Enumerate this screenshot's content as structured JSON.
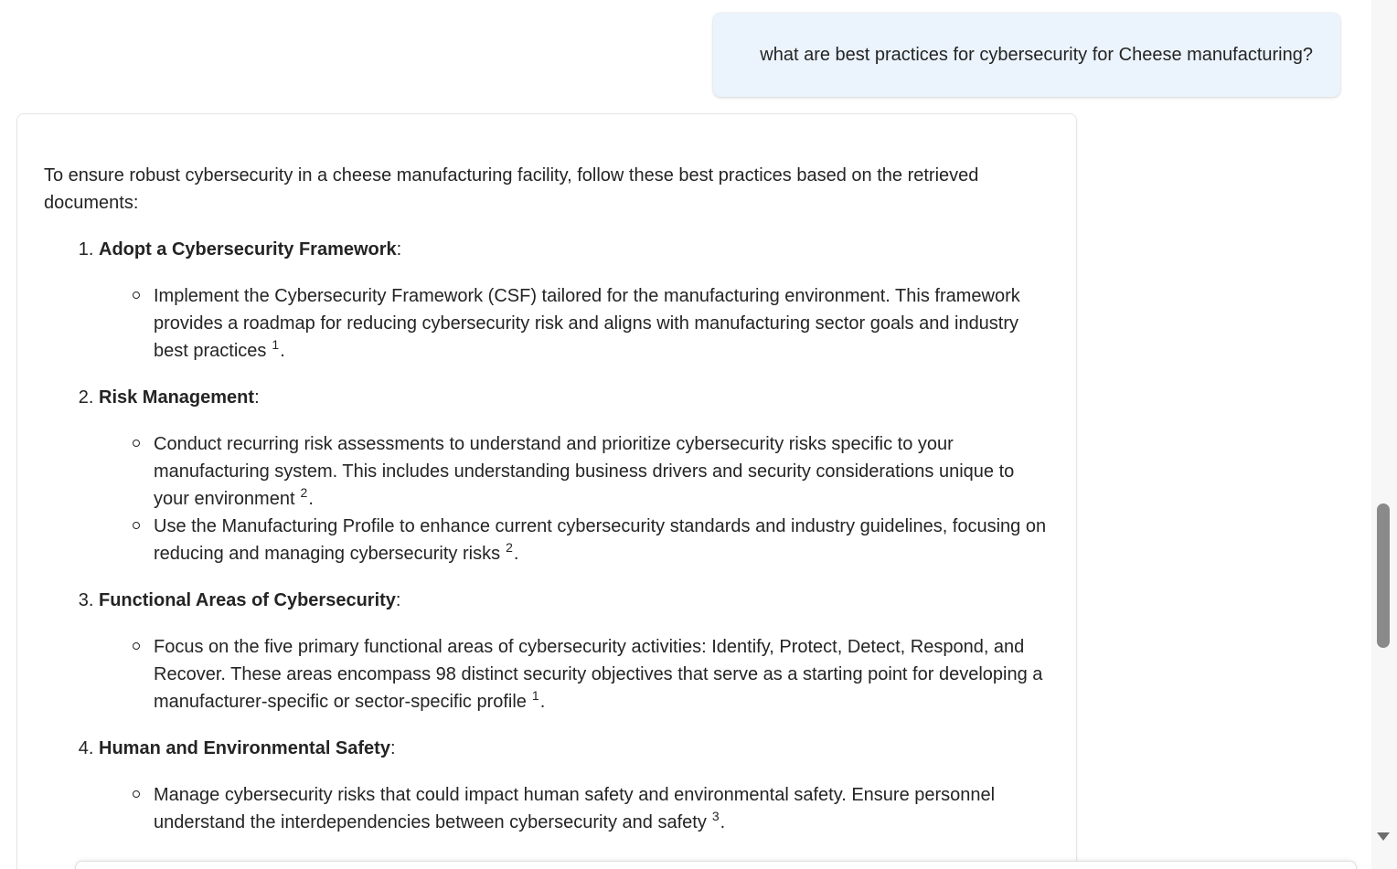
{
  "chat": {
    "user_message": "what are best practices for cybersecurity for Cheese manufacturing?",
    "response": {
      "intro": "To ensure robust cybersecurity in a cheese manufacturing facility, follow these best practices based on the retrieved documents:",
      "items": [
        {
          "title": "Adopt a Cybersecurity Framework",
          "bullets": [
            {
              "text": "Implement the Cybersecurity Framework (CSF) tailored for the manufacturing environment. This framework provides a roadmap for reducing cybersecurity risk and aligns with manufacturing sector goals and industry best practices",
              "cite": "1"
            }
          ]
        },
        {
          "title": "Risk Management",
          "bullets": [
            {
              "text": "Conduct recurring risk assessments to understand and prioritize cybersecurity risks specific to your manufacturing system. This includes understanding business drivers and security considerations unique to your environment",
              "cite": "2"
            },
            {
              "text": "Use the Manufacturing Profile to enhance current cybersecurity standards and industry guidelines, focusing on reducing and managing cybersecurity risks",
              "cite": "2"
            }
          ]
        },
        {
          "title": "Functional Areas of Cybersecurity",
          "bullets": [
            {
              "text": "Focus on the five primary functional areas of cybersecurity activities: Identify, Protect, Detect, Respond, and Recover. These areas encompass 98 distinct security objectives that serve as a starting point for developing a manufacturer-specific or sector-specific profile",
              "cite": "1"
            }
          ]
        },
        {
          "title": "Human and Environmental Safety",
          "bullets": [
            {
              "text": "Manage cybersecurity risks that could impact human safety and environmental safety. Ensure personnel understand the interdependencies between cybersecurity and safety",
              "cite": "3"
            }
          ]
        }
      ]
    }
  },
  "colors": {
    "user_bubble_bg": "#ebf3fc",
    "text": "#242424",
    "card_border": "#e6e6e6",
    "scroll_thumb": "#8a8a8a"
  },
  "icons": {
    "scroll_down": "triangle-down-icon"
  }
}
